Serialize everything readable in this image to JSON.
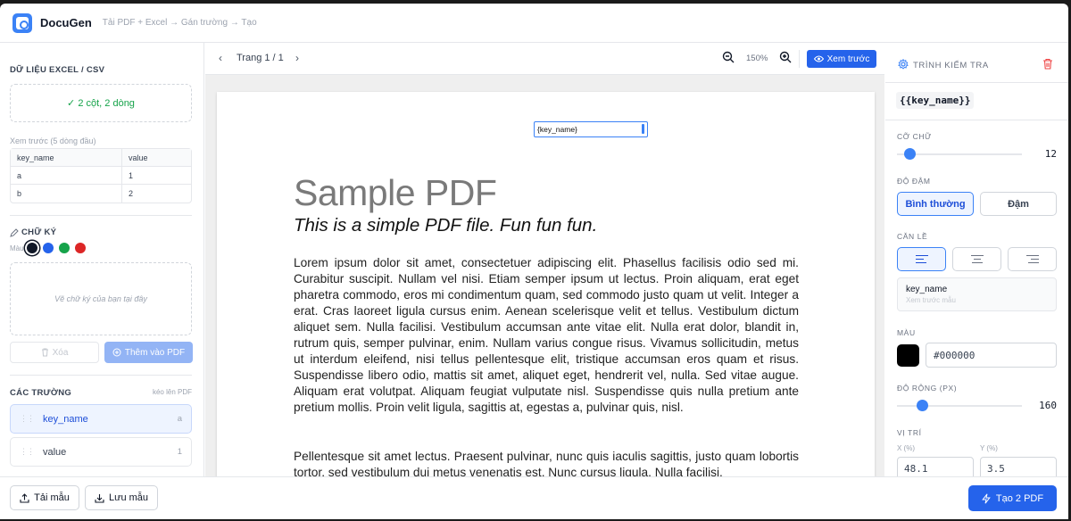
{
  "header": {
    "app_title": "DocuGen",
    "breadcrumb": "Tải PDF + Excel → Gán trường → Tạo"
  },
  "left": {
    "data_title": "DỮ LIỆU EXCEL / CSV",
    "data_status": "✓ 2 cột, 2 dòng",
    "preview_label": "Xem trước (5 dòng đầu)",
    "table": {
      "headers": [
        "key_name",
        "value"
      ],
      "rows": [
        [
          "a",
          "1"
        ],
        [
          "b",
          "2"
        ]
      ]
    },
    "signature_title": "CHỮ KÝ",
    "color_label": "Màu",
    "colors": [
      "#111827",
      "#2563eb",
      "#16a34a",
      "#dc2626"
    ],
    "signature_placeholder": "Vẽ chữ ký của bạn tại đây",
    "delete_label": "Xóa",
    "add_label": "Thêm vào PDF",
    "fields_title": "CÁC TRƯỜNG",
    "fields_hint": "kéo lên PDF",
    "fields": [
      {
        "name": "key_name",
        "count": "a"
      },
      {
        "name": "value",
        "count": "1"
      }
    ]
  },
  "center": {
    "page_indicator": "Trang 1 / 1",
    "zoom": "150%",
    "preview_button": "Xem trước",
    "field_box_text": "{key_name}",
    "pdf": {
      "title": "Sample PDF",
      "subtitle": "This is a simple PDF file. Fun fun fun.",
      "paragraph1": "Lorem ipsum dolor sit amet, consectetuer adipiscing elit. Phasellus facilisis odio sed mi. Curabitur suscipit. Nullam vel nisi. Etiam semper ipsum ut lectus. Proin aliquam, erat eget pharetra commodo, eros mi condimentum quam, sed commodo justo quam ut velit. Integer a erat. Cras laoreet ligula cursus enim. Aenean scelerisque velit et tellus. Vestibulum dictum aliquet sem. Nulla facilisi. Vestibulum accumsan ante vitae elit. Nulla erat dolor, blandit in, rutrum quis, semper pulvinar, enim. Nullam varius congue risus. Vivamus sollicitudin, metus ut interdum eleifend, nisi tellus pellentesque elit, tristique accumsan eros quam et risus. Suspendisse libero odio, mattis sit amet, aliquet eget, hendrerit vel, nulla. Sed vitae augue. Aliquam erat volutpat. Aliquam feugiat vulputate nisl. Suspendisse quis nulla pretium ante pretium mollis. Proin velit ligula, sagittis at, egestas a, pulvinar quis, nisl.",
      "paragraph2": "Pellentesque sit amet lectus. Praesent pulvinar, nunc quis iaculis sagittis, justo quam lobortis tortor, sed vestibulum dui metus venenatis est. Nunc cursus ligula. Nulla facilisi."
    }
  },
  "inspector": {
    "title": "TRÌNH KIỂM TRA",
    "key_chip": "{{key_name}}",
    "font_size_label": "CỠ CHỮ",
    "font_size": "12",
    "font_size_level": 0.1,
    "weight_label": "ĐỘ ĐẬM",
    "weight_normal": "Bình thường",
    "weight_bold": "Đậm",
    "align_label": "CĂN LỀ",
    "field_name": "key_name",
    "field_sub": "Xem trước mẫu",
    "color_label": "MÀU",
    "color_value": "#000000",
    "width_label": "ĐỘ RỘNG (PX)",
    "width_value": "160",
    "width_level": 0.2,
    "position_label": "VỊ TRÍ",
    "x_label": "X (%)",
    "y_label": "Y (%)",
    "x_value": "48.1",
    "y_value": "3.5"
  },
  "footer": {
    "load_template": "Tải mẫu",
    "save_template": "Lưu mẫu",
    "generate": "Tạo 2 PDF"
  }
}
